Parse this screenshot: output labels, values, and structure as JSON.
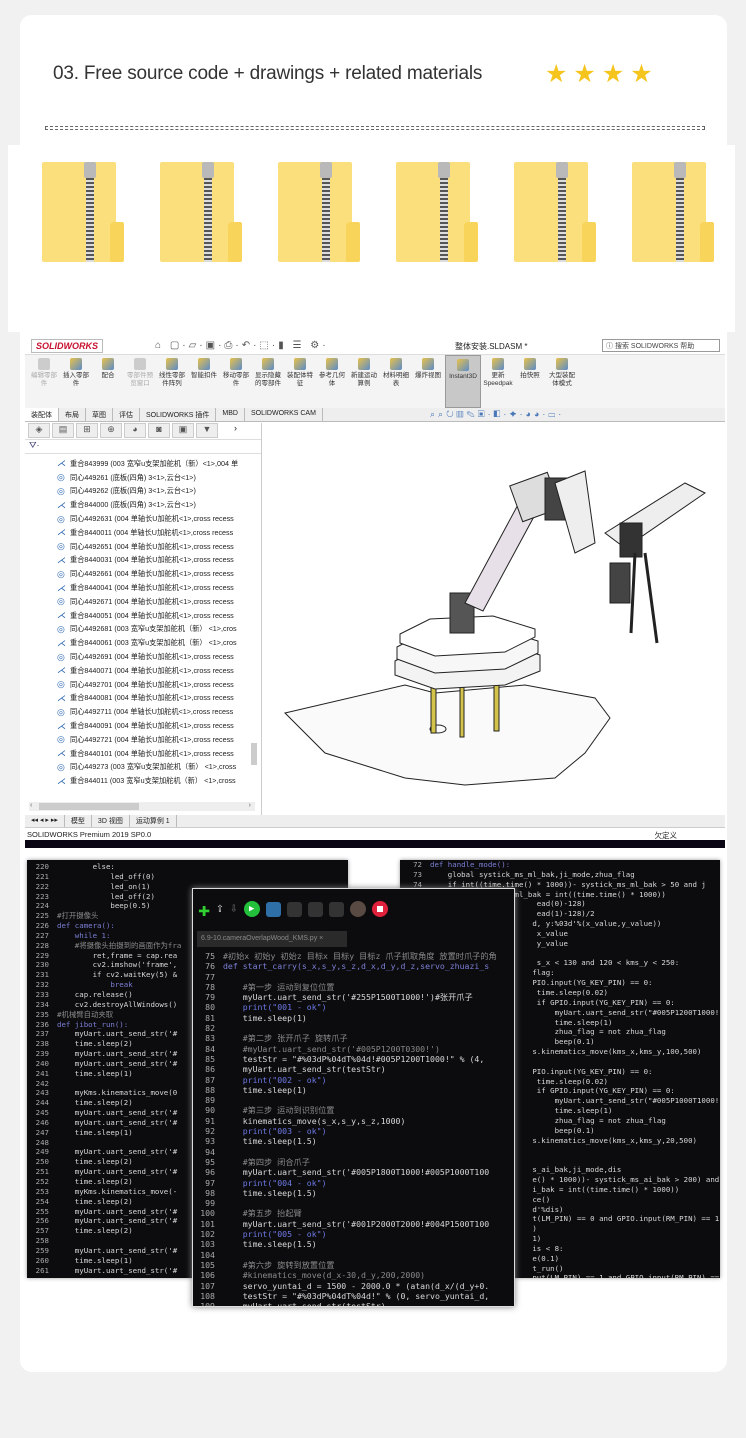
{
  "heading": "03. Free source code + drawings + related materials",
  "rating": {
    "stars": 4,
    "color": "#f6c51d"
  },
  "folders": [
    "zip-folder",
    "zip-folder",
    "zip-folder",
    "zip-folder",
    "zip-folder",
    "zip-folder"
  ],
  "solidworks": {
    "logo": "SOLIDWORKS",
    "document_title": "整体安装.SLDASM *",
    "search_placeholder": "搜索 SOLIDWORKS 帮助",
    "ribbon": [
      {
        "label": "编辑零部件",
        "state": "disabled"
      },
      {
        "label": "插入零部件"
      },
      {
        "label": "配合"
      },
      {
        "label": "零部件预览窗口",
        "state": "disabled"
      },
      {
        "label": "线性零部件阵列"
      },
      {
        "label": "智能扣件"
      },
      {
        "label": "移动零部件"
      },
      {
        "label": "显示隐藏的零部件"
      },
      {
        "label": "装配体特征"
      },
      {
        "label": "参考几何体"
      },
      {
        "label": "新建运动算例"
      },
      {
        "label": "材料明细表"
      },
      {
        "label": "爆炸视图"
      },
      {
        "label": "Instant3D",
        "state": "selected"
      },
      {
        "label": "更新Speedpak"
      },
      {
        "label": "拍快照"
      },
      {
        "label": "大型装配体模式"
      }
    ],
    "tabs": [
      "装配体",
      "布局",
      "草图",
      "评估",
      "SOLIDWORKS 插件",
      "MBD",
      "SOLIDWORKS CAM"
    ],
    "tree": [
      {
        "t": "mate",
        "label": "重合843999 (003 宽窄u支架加舵机（新）<1>,004 单"
      },
      {
        "t": "concentric",
        "label": "同心449261 (底板(四角) 3<1>,云台<1>)"
      },
      {
        "t": "concentric",
        "label": "同心449262 (底板(四角) 3<1>,云台<1>)"
      },
      {
        "t": "mate",
        "label": "重合844000 (底板(四角) 3<1>,云台<1>)"
      },
      {
        "t": "concentric",
        "label": "同心4492631 (004 单轴长U加舵机<1>,cross recess"
      },
      {
        "t": "mate",
        "label": "重合8440011 (004 单轴长U加舵机<1>,cross recess"
      },
      {
        "t": "concentric",
        "label": "同心4492651 (004 单轴长U加舵机<1>,cross recess"
      },
      {
        "t": "mate",
        "label": "重合8440031 (004 单轴长U加舵机<1>,cross recess"
      },
      {
        "t": "concentric",
        "label": "同心4492661 (004 单轴长U加舵机<1>,cross recess"
      },
      {
        "t": "mate",
        "label": "重合8440041 (004 单轴长U加舵机<1>,cross recess"
      },
      {
        "t": "concentric",
        "label": "同心4492671 (004 单轴长U加舵机<1>,cross recess"
      },
      {
        "t": "mate",
        "label": "重合8440051 (004 单轴长U加舵机<1>,cross recess"
      },
      {
        "t": "concentric",
        "label": "同心4492681 (003 宽窄u支架加舵机（新） <1>,cros"
      },
      {
        "t": "mate",
        "label": "重合8440061 (003 宽窄u支架加舵机（新） <1>,cros"
      },
      {
        "t": "concentric",
        "label": "同心4492691 (004 单轴长U加舵机<1>,cross recess"
      },
      {
        "t": "mate",
        "label": "重合8440071 (004 单轴长U加舵机<1>,cross recess"
      },
      {
        "t": "concentric",
        "label": "同心4492701 (004 单轴长U加舵机<1>,cross recess"
      },
      {
        "t": "mate",
        "label": "重合8440081 (004 单轴长U加舵机<1>,cross recess"
      },
      {
        "t": "concentric",
        "label": "同心4492711 (004 单轴长U加舵机<1>,cross recess"
      },
      {
        "t": "mate",
        "label": "重合8440091 (004 单轴长U加舵机<1>,cross recess"
      },
      {
        "t": "concentric",
        "label": "同心4492721 (004 单轴长U加舵机<1>,cross recess"
      },
      {
        "t": "mate",
        "label": "重合8440101 (004 单轴长U加舵机<1>,cross recess"
      },
      {
        "t": "concentric",
        "label": "同心449273 (003 宽窄u支架加舵机（新） <1>,cross"
      },
      {
        "t": "mate",
        "label": "重合844011 (003 宽窄u支架加舵机（新） <1>,cross"
      }
    ],
    "bottom_tabs": [
      "模型",
      "3D 视图",
      "运动算例 1"
    ],
    "status": "SOLIDWORKS Premium 2019 SP0.0",
    "status_right": "欠定义"
  },
  "code_left": [
    {
      "n": "220",
      "k": "",
      "t": "        else:"
    },
    {
      "n": "221",
      "k": "",
      "t": "            led_off(0)"
    },
    {
      "n": "222",
      "k": "",
      "t": "            led_on(1)"
    },
    {
      "n": "223",
      "k": "",
      "t": "            led_off(2)"
    },
    {
      "n": "224",
      "k": "",
      "t": "            beep(0.5)"
    },
    {
      "n": "225",
      "k": "cm",
      "t": "#打开摄像头"
    },
    {
      "n": "226",
      "k": "kw",
      "t": "def camera():"
    },
    {
      "n": "227",
      "k": "kw",
      "t": "    while 1:"
    },
    {
      "n": "228",
      "k": "cm",
      "t": "    #将摄像头拍摄到的画面作为fra"
    },
    {
      "n": "229",
      "k": "",
      "t": "        ret,frame = cap.rea"
    },
    {
      "n": "230",
      "k": "",
      "t": "        cv2.imshow('frame',"
    },
    {
      "n": "231",
      "k": "",
      "t": "        if cv2.waitKey(5) &"
    },
    {
      "n": "232",
      "k": "kw",
      "t": "            break"
    },
    {
      "n": "233",
      "k": "",
      "t": "    cap.release()"
    },
    {
      "n": "234",
      "k": "",
      "t": "    cv2.destroyAllWindows()"
    },
    {
      "n": "235",
      "k": "cm",
      "t": "#机械臂自动夹取"
    },
    {
      "n": "236",
      "k": "kw",
      "t": "def jibot_run():"
    },
    {
      "n": "237",
      "k": "",
      "t": "    myUart.uart_send_str('#"
    },
    {
      "n": "238",
      "k": "",
      "t": "    time.sleep(2)"
    },
    {
      "n": "239",
      "k": "",
      "t": "    myUart.uart_send_str('#"
    },
    {
      "n": "240",
      "k": "",
      "t": "    myUart.uart_send_str('#"
    },
    {
      "n": "241",
      "k": "",
      "t": "    time.sleep(1)"
    },
    {
      "n": "242",
      "k": "",
      "t": ""
    },
    {
      "n": "243",
      "k": "",
      "t": "    myKms.kinematics_move(0"
    },
    {
      "n": "244",
      "k": "",
      "t": "    time.sleep(2)"
    },
    {
      "n": "245",
      "k": "",
      "t": "    myUart.uart_send_str('#"
    },
    {
      "n": "246",
      "k": "",
      "t": "    myUart.uart_send_str('#"
    },
    {
      "n": "247",
      "k": "",
      "t": "    time.sleep(1)"
    },
    {
      "n": "248",
      "k": "",
      "t": ""
    },
    {
      "n": "249",
      "k": "",
      "t": "    myUart.uart_send_str('#"
    },
    {
      "n": "250",
      "k": "",
      "t": "    time.sleep(2)"
    },
    {
      "n": "251",
      "k": "",
      "t": "    myUart.uart_send_str('#"
    },
    {
      "n": "252",
      "k": "",
      "t": "    time.sleep(2)"
    },
    {
      "n": "253",
      "k": "",
      "t": "    myKms.kinematics_move(-"
    },
    {
      "n": "254",
      "k": "",
      "t": "    time.sleep(2)"
    },
    {
      "n": "255",
      "k": "",
      "t": "    myUart.uart_send_str('#"
    },
    {
      "n": "256",
      "k": "",
      "t": "    myUart.uart_send_str('#"
    },
    {
      "n": "257",
      "k": "",
      "t": "    time.sleep(2)"
    },
    {
      "n": "258",
      "k": "",
      "t": ""
    },
    {
      "n": "259",
      "k": "",
      "t": "    myUart.uart_send_str('#"
    },
    {
      "n": "260",
      "k": "",
      "t": "    time.sleep(1)"
    },
    {
      "n": "261",
      "k": "",
      "t": "    myUart.uart_send_str('#"
    }
  ],
  "code_right": [
    {
      "n": "72",
      "k": "kw",
      "t": "def handle_mode():"
    },
    {
      "n": "73",
      "k": "",
      "t": "    global systick_ms_ml_bak,ji_mode,zhua_flag"
    },
    {
      "n": "74",
      "k": "",
      "t": "    if int((time.time() * 1000))- systick_ms_ml_bak > 50 and j"
    },
    {
      "n": "75",
      "k": "",
      "t": "        systick_ms_ml_bak = int((time.time() * 1000))"
    },
    {
      "n": "",
      "k": "",
      "t": "                        ead(0)-128)"
    },
    {
      "n": "",
      "k": "",
      "t": "                        ead(1)-128)/2"
    },
    {
      "n": "",
      "k": "",
      "t": "                       d, y:%03d'%(x_value,y_value))"
    },
    {
      "n": "",
      "k": "",
      "t": "                        x_value"
    },
    {
      "n": "",
      "k": "",
      "t": "                        y_value"
    },
    {
      "n": "",
      "k": "",
      "t": ""
    },
    {
      "n": "",
      "k": "",
      "t": "                        s_x < 130 and 120 < kms_y < 250:"
    },
    {
      "n": "",
      "k": "",
      "t": "                       flag:"
    },
    {
      "n": "",
      "k": "",
      "t": "                       PIO.input(YG_KEY_PIN) == 0:"
    },
    {
      "n": "",
      "k": "",
      "t": "                        time.sleep(0.02)"
    },
    {
      "n": "",
      "k": "",
      "t": "                        if GPIO.input(YG_KEY_PIN) == 0:"
    },
    {
      "n": "",
      "k": "",
      "t": "                            myUart.uart_send_str(\"#005P1200T1000!\""
    },
    {
      "n": "",
      "k": "",
      "t": "                            time.sleep(1)"
    },
    {
      "n": "",
      "k": "",
      "t": "                            zhua_flag = not zhua_flag"
    },
    {
      "n": "",
      "k": "",
      "t": "                            beep(0.1)"
    },
    {
      "n": "",
      "k": "",
      "t": "                       s.kinematics_move(kms_x,kms_y,100,500)"
    },
    {
      "n": "",
      "k": "",
      "t": ""
    },
    {
      "n": "",
      "k": "",
      "t": "                       PIO.input(YG_KEY_PIN) == 0:"
    },
    {
      "n": "",
      "k": "",
      "t": "                        time.sleep(0.02)"
    },
    {
      "n": "",
      "k": "",
      "t": "                        if GPIO.input(YG_KEY_PIN) == 0:"
    },
    {
      "n": "",
      "k": "",
      "t": "                            myUart.uart_send_str(\"#005P1000T1000!\""
    },
    {
      "n": "",
      "k": "",
      "t": "                            time.sleep(1)"
    },
    {
      "n": "",
      "k": "",
      "t": "                            zhua_flag = not zhua_flag"
    },
    {
      "n": "",
      "k": "",
      "t": "                            beep(0.1)"
    },
    {
      "n": "",
      "k": "",
      "t": "                       s.kinematics_move(kms_x,kms_y,20,500)"
    },
    {
      "n": "",
      "k": "",
      "t": ""
    },
    {
      "n": "",
      "k": "",
      "t": ""
    },
    {
      "n": "",
      "k": "",
      "t": "                       s_ai_bak,ji_mode,dis"
    },
    {
      "n": "",
      "k": "",
      "t": "                       e() * 1000))- systick_ms_ai_bak > 200) and"
    },
    {
      "n": "",
      "k": "",
      "t": "                       i_bak = int((time.time() * 1000))"
    },
    {
      "n": "",
      "k": "",
      "t": "                       ce()"
    },
    {
      "n": "",
      "k": "",
      "t": "                       d'%dis)"
    },
    {
      "n": "",
      "k": "",
      "t": "                       t(LM_PIN) == 0 and GPIO.input(RM_PIN) == 1"
    },
    {
      "n": "",
      "k": "",
      "t": "                       )"
    },
    {
      "n": "",
      "k": "",
      "t": "                       1)"
    },
    {
      "n": "",
      "k": "",
      "t": "                       is < 8:"
    },
    {
      "n": "",
      "k": "",
      "t": "                       e(0.1)"
    },
    {
      "n": "",
      "k": "",
      "t": "                       t_run()"
    },
    {
      "n": "",
      "k": "",
      "t": "                       put(LM_PIN) == 1 and GPIO.input(RM_PIN) =="
    }
  ],
  "code_mid": {
    "file_tab": "6.9-10.cameraOverlapWood_KMS.py ×",
    "lines": [
      {
        "n": "75",
        "k": "cm",
        "t": "#初始x 初始y 初始z 目标x 目标y 目标z 爪子抓取角度 放置时爪子的角"
      },
      {
        "n": "76",
        "k": "kw",
        "t": "def start_carry(s_x,s_y,s_z,d_x,d_y,d_z,servo_zhuazi_s"
      },
      {
        "n": "77",
        "k": "",
        "t": ""
      },
      {
        "n": "78",
        "k": "cm",
        "t": "    #第一步 运动到复位位置"
      },
      {
        "n": "79",
        "k": "",
        "t": "    myUart.uart_send_str('#255P1500T1000!')#张开爪子"
      },
      {
        "n": "80",
        "k": "pr",
        "t": "    print(\"001 - ok\")"
      },
      {
        "n": "81",
        "k": "",
        "t": "    time.sleep(1)"
      },
      {
        "n": "82",
        "k": "",
        "t": ""
      },
      {
        "n": "83",
        "k": "cm",
        "t": "    #第二步 张开爪子 旋转爪子"
      },
      {
        "n": "84",
        "k": "cm",
        "t": "    #myUart.uart_send_str('#005P1200T0300!')"
      },
      {
        "n": "85",
        "k": "",
        "t": "    testStr = \"#%03dP%04dT%04d!#005P1200T1000!\" % (4,"
      },
      {
        "n": "86",
        "k": "",
        "t": "    myUart.uart_send_str(testStr)"
      },
      {
        "n": "87",
        "k": "pr",
        "t": "    print(\"002 - ok\")"
      },
      {
        "n": "88",
        "k": "",
        "t": "    time.sleep(1)"
      },
      {
        "n": "89",
        "k": "",
        "t": ""
      },
      {
        "n": "90",
        "k": "cm",
        "t": "    #第三步 运动到识别位置"
      },
      {
        "n": "91",
        "k": "",
        "t": "    kinematics_move(s_x,s_y,s_z,1000)"
      },
      {
        "n": "92",
        "k": "pr",
        "t": "    print(\"003 - ok\")"
      },
      {
        "n": "93",
        "k": "",
        "t": "    time.sleep(1.5)"
      },
      {
        "n": "94",
        "k": "",
        "t": ""
      },
      {
        "n": "95",
        "k": "cm",
        "t": "    #第四步 闭合爪子"
      },
      {
        "n": "96",
        "k": "",
        "t": "    myUart.uart_send_str('#005P1800T1000!#005P1000T100"
      },
      {
        "n": "97",
        "k": "pr",
        "t": "    print(\"004 - ok\")"
      },
      {
        "n": "98",
        "k": "",
        "t": "    time.sleep(1.5)"
      },
      {
        "n": "99",
        "k": "",
        "t": ""
      },
      {
        "n": "100",
        "k": "cm",
        "t": "    #第五步 抬起臂"
      },
      {
        "n": "101",
        "k": "",
        "t": "    myUart.uart_send_str('#001P2000T2000!#004P1500T100"
      },
      {
        "n": "102",
        "k": "pr",
        "t": "    print(\"005 - ok\")"
      },
      {
        "n": "103",
        "k": "",
        "t": "    time.sleep(1.5)"
      },
      {
        "n": "104",
        "k": "",
        "t": ""
      },
      {
        "n": "105",
        "k": "cm",
        "t": "    #第六步 旋转到放置位置"
      },
      {
        "n": "106",
        "k": "cm",
        "t": "    #kinematics_move(d_x-30,d_y,200,2000)"
      },
      {
        "n": "107",
        "k": "",
        "t": "    servo_yuntai_d = 1500 - 2000.0 * (atan(d_x/(d_y+0."
      },
      {
        "n": "108",
        "k": "",
        "t": "    testStr = \"#%03dP%04dT%04d!\" % (0, servo_yuntai_d,"
      },
      {
        "n": "109",
        "k": "",
        "t": "    myUart.uart_send_str(testStr)"
      }
    ]
  }
}
